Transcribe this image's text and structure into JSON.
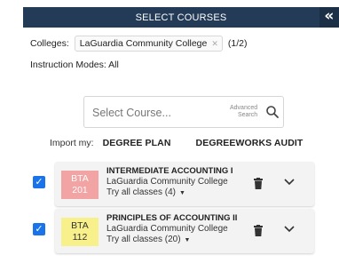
{
  "header": {
    "title": "SELECT COURSES",
    "collapse_icon": "double-chevron-left-icon"
  },
  "filters": {
    "colleges_label": "Colleges:",
    "college_chip": "LaGuardia Community College",
    "college_count": "(1/2)",
    "modes_label": "Instruction Modes:",
    "modes_value": "All"
  },
  "search": {
    "placeholder": "Select Course...",
    "advanced_line1": "Advanced",
    "advanced_line2": "Search"
  },
  "import": {
    "label": "Import my:",
    "degree_plan": "DEGREE PLAN",
    "degreeworks": "DEGREEWORKS AUDIT"
  },
  "courses": [
    {
      "subject": "BTA",
      "number": "201",
      "title": "INTERMEDIATE ACCOUNTING I",
      "college": "LaGuardia Community College",
      "try": "Try all classes (4)",
      "checked": true,
      "badge_color": "#f2a3a3"
    },
    {
      "subject": "BTA",
      "number": "112",
      "title": "PRINCIPLES OF ACCOUNTING II",
      "college": "LaGuardia Community College",
      "try": "Try all classes (20)",
      "checked": true,
      "badge_color": "#f8f08a"
    }
  ],
  "colors": {
    "header_bg": "#243b57",
    "checkbox": "#1a73e8"
  }
}
